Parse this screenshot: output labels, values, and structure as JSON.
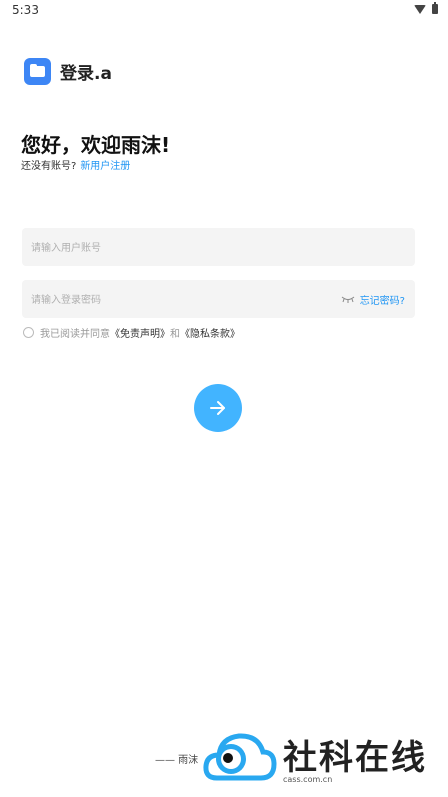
{
  "status": {
    "time": "5:33"
  },
  "header": {
    "title": "登录.a"
  },
  "greeting": {
    "title": "您好，欢迎雨沫!",
    "no_account": "还没有账号?",
    "register": "新用户注册"
  },
  "form": {
    "username_placeholder": "请输入用户账号",
    "password_placeholder": "请输入登录密码",
    "forgot": "忘记密码?"
  },
  "agreement": {
    "prefix": "我已阅读并同意",
    "disclaimer": "《免责声明》",
    "and": "和",
    "privacy": "《隐私条款》"
  },
  "footer": {
    "text": "—— 雨沫"
  },
  "watermark": {
    "brand": "社科在线",
    "site": "cass.com.cn"
  },
  "colors": {
    "accent": "#2196f3",
    "button": "#42b4ff",
    "app_icon": "#3d86f5"
  }
}
